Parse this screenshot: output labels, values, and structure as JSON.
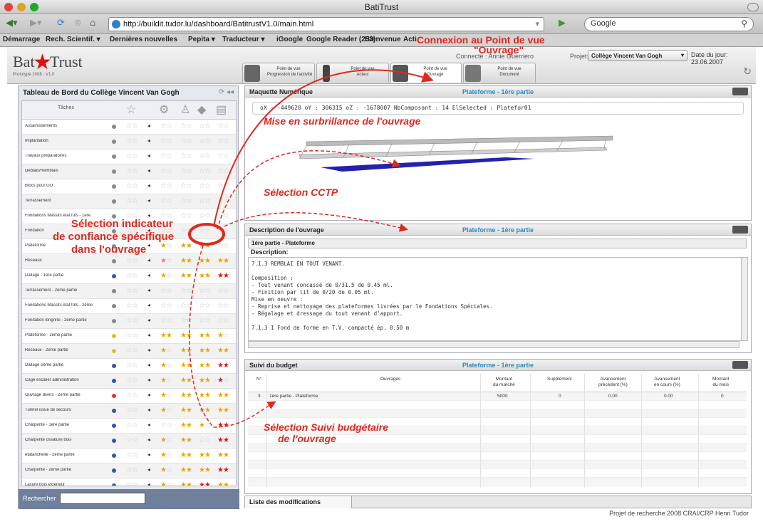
{
  "window": {
    "title": "BatiTrust"
  },
  "toolbar": {
    "url": "http://buildit.tudor.lu/dashboard/BatitrustV1.0/main.html",
    "search_label": "Google"
  },
  "bookmarks": [
    "Démarrage",
    "Rech. Scientif. ▾",
    "Dernières nouvelles",
    "Pepita ▾",
    "Traducteur ▾",
    "iGoogle",
    "Google Reader (253)",
    "Bienvenue",
    "Acti"
  ],
  "app": {
    "logo_bat": "Bat",
    "logo_trust": "Trust",
    "logo_version": "Prototype 2008 - V1.0",
    "connecte": "Connecté : Annie Guerriero",
    "projet_label": "Projet:",
    "projet_value": "Collège Vincent Van Gogh",
    "date": "Date du jour: 23.06.2007",
    "tabs": [
      {
        "label": "Point de vue\nProgression de l'activité"
      },
      {
        "label": "Point de vue\nActeur"
      },
      {
        "label": "Point de vue\nOuvrage"
      },
      {
        "label": "Point de vue\nDocument"
      }
    ]
  },
  "left": {
    "title": "Tableau de Bord du Collège Vincent Van Gogh",
    "col_taches": "Tâches",
    "search_label": "Rechercher",
    "rows": [
      {
        "name": "Assainissements",
        "dot": "#888888",
        "s": [
          "00",
          "00",
          "00",
          "00"
        ]
      },
      {
        "name": "Implantation",
        "dot": "#888888",
        "s": [
          "00",
          "00",
          "00",
          "00"
        ]
      },
      {
        "name": "Travaux préparatoires",
        "dot": "#888888",
        "s": [
          "00",
          "00",
          "00",
          "00"
        ]
      },
      {
        "name": "Déblais/Remblais",
        "dot": "#888888",
        "s": [
          "00",
          "00",
          "00",
          "00"
        ]
      },
      {
        "name": "Blocs pour GO",
        "dot": "#888888",
        "s": [
          "00",
          "00",
          "00",
          "00"
        ]
      },
      {
        "name": "Terrassement",
        "dot": "#888888",
        "s": [
          "00",
          "00",
          "00",
          "00"
        ]
      },
      {
        "name": "Fondations Massifs etat fûts - 1ère",
        "dot": "#888888",
        "s": [
          "00",
          "00",
          "00",
          "00"
        ]
      },
      {
        "name": "Fondation",
        "dot": "#888888",
        "s": [
          "00",
          "00",
          "00",
          "00"
        ]
      },
      {
        "name": "Plateforme",
        "dot": "#888888",
        "s": [
          "Y0",
          "YY",
          "YY",
          "00"
        ]
      },
      {
        "name": "Réseaux",
        "dot": "#888888",
        "s": [
          "r0",
          "YY",
          "YY",
          "YY"
        ]
      },
      {
        "name": "Dallage - 1ère partie",
        "dot": "#3355aa",
        "s": [
          "Y0",
          "YY",
          "YY",
          "RR"
        ]
      },
      {
        "name": "Terrassement - 2ème partie",
        "dot": "#888888",
        "s": [
          "00",
          "00",
          "00",
          "00"
        ]
      },
      {
        "name": "Fondations Massifs etat fûts - 2ème",
        "dot": "#888888",
        "s": [
          "00",
          "00",
          "00",
          "00"
        ]
      },
      {
        "name": "Fondation longrine - 2ème partie",
        "dot": "#888888",
        "s": [
          "00",
          "00",
          "00",
          "00"
        ]
      },
      {
        "name": "Plateforme - 2ème partie",
        "dot": "#e0c020",
        "s": [
          "YY",
          "YY",
          "YY",
          "Y0"
        ]
      },
      {
        "name": "Réseaux - 2ème partie",
        "dot": "#e0c020",
        "s": [
          "Y0",
          "YY",
          "YY",
          "YY"
        ]
      },
      {
        "name": "Dallage-2ème partie",
        "dot": "#3355aa",
        "s": [
          "Y0",
          "YY",
          "YY",
          "RR"
        ]
      },
      {
        "name": "Cage escalier administration",
        "dot": "#3355aa",
        "s": [
          "Y0",
          "YY",
          "YY",
          "R0"
        ]
      },
      {
        "name": "Ouvrage divers - 2ème partie",
        "dot": "#dd3333",
        "s": [
          "Y0",
          "YY",
          "YY",
          "YY"
        ]
      },
      {
        "name": "Tunnel issue de secours",
        "dot": "#3355aa",
        "s": [
          "Y0",
          "YY",
          "YY",
          "YY"
        ]
      },
      {
        "name": "Charpente - 1ère partie",
        "dot": "#3355aa",
        "s": [
          "00",
          "YY",
          "Y0",
          "RR"
        ]
      },
      {
        "name": "Charpente ossature bois",
        "dot": "#3355aa",
        "s": [
          "Y0",
          "YY",
          "00",
          "RR"
        ]
      },
      {
        "name": "etatanchéité - 2ème partie",
        "dot": "#3355aa",
        "s": [
          "Y0",
          "YY",
          "YY",
          "YY"
        ]
      },
      {
        "name": "Charpente - 2ème partie",
        "dot": "#3355aa",
        "s": [
          "Y0",
          "YY",
          "YY",
          "RR"
        ]
      },
      {
        "name": "Lasure bois extérieur",
        "dot": "#3355aa",
        "s": [
          "Y0",
          "YY",
          "RR",
          "YY"
        ]
      }
    ]
  },
  "maquette": {
    "title": "Maquette Numérique",
    "subtitle": "Plateforme - 1ère partie",
    "coords": "oX : -449620  oY : 306315  oZ : -1678007  NbComposant : 14  ElSelected : Platefor01"
  },
  "description": {
    "title": "Description de l'ouvrage",
    "subtitle": "Plateforme - 1ère partie",
    "sub_header": "1ère partie - Plateforme",
    "label": "Description:",
    "body": "7.1.3 REMBLAI EN TOUT VENANT.\n\nComposition :\n- Tout venant concassé de 0/31.5 de 0.45 ml.\n- Finition par lit de 0/20 de 0.05 ml.\nMise en oeuvre :\n- Reprise et nettoyage des plateformes livrées par le Fondations Spéciales.\n- Régalage et dressage du tout venant d'apport.\n\n7.1.3 1 Fond de forme en T.V. compacté ép. 0.50 m"
  },
  "budget": {
    "title": "Suivi du budget",
    "subtitle": "Plateforme - 1ère partie",
    "headers": [
      "N°",
      "Ouvrages",
      "Montant\ndu marché",
      "Supplément",
      "Avancement\nprécédent (%)",
      "Avancement\nen cours (%)",
      "Montant\ndu mois"
    ],
    "row": [
      "3",
      "1ère partie - Plateforme",
      "5000",
      "0",
      "0.00",
      "0.00",
      "0"
    ]
  },
  "bottom": {
    "tab": "Liste des modifications",
    "footer": "Projet de recherche 2008 CRAI/CRP Henri Tudor"
  },
  "annotations": {
    "connexion": "Connexion au Point de vue",
    "connexion2": "\"Ouvrage\"",
    "surbrillance": "Mise en surbrillance de l'ouvrage",
    "cctp": "Sélection CCTP",
    "indicateur1": "Sélection indicateur",
    "indicateur2": "de confiance spécifique",
    "indicateur3": "dans l'ouvrage",
    "budget1": "Sélection Suivi budgétaire",
    "budget2": "de l'ouvrage"
  }
}
